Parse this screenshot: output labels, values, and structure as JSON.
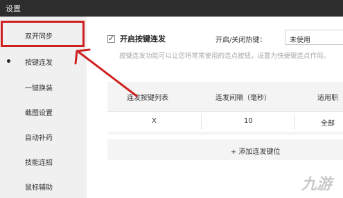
{
  "window": {
    "title": "设置"
  },
  "sidebar": {
    "items": [
      {
        "label": "双开同步",
        "active": false
      },
      {
        "label": "按键连发",
        "active": true
      },
      {
        "label": "一键换装",
        "active": false
      },
      {
        "label": "截图设置",
        "active": false
      },
      {
        "label": "自动补药",
        "active": false
      },
      {
        "label": "技能连招",
        "active": false
      },
      {
        "label": "鼠标辅助",
        "active": false
      }
    ]
  },
  "main": {
    "enable": {
      "label": "开启按键连发",
      "checked": true
    },
    "hotkey": {
      "label": "开启/关闭热键：",
      "value": "未使用"
    },
    "description": "按键连发功能可以让您将常常使用的连点按钮，设置为快捷键连点作用。",
    "table": {
      "headers": [
        "连发按键列表",
        "连发间隔（毫秒）",
        "适用职"
      ],
      "rows": [
        {
          "key": "X",
          "interval": "10",
          "scope": "全部"
        }
      ]
    },
    "add_button": "+ 添加连发键位"
  },
  "annotation": {
    "box_color": "#cf2020",
    "arrow_color": "#cf2020"
  },
  "watermark": {
    "text": "九游"
  }
}
